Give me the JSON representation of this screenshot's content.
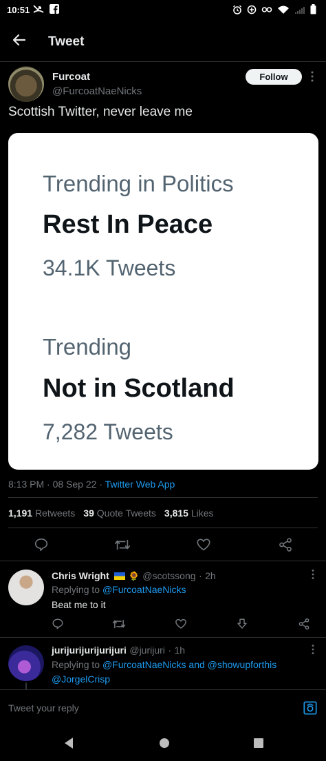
{
  "status_bar": {
    "time": "10:51"
  },
  "header": {
    "title": "Tweet"
  },
  "tweet": {
    "author_name": "Furcoat",
    "author_handle": "@FurcoatNaeNicks",
    "follow_label": "Follow",
    "text": "Scottish Twitter, never leave me",
    "image": {
      "line1": "Trending in Politics",
      "line2": "Rest In Peace",
      "line3": "34.1K Tweets",
      "line4": "Trending",
      "line5": "Not in Scotland",
      "line6": "7,282 Tweets"
    },
    "time": "8:13 PM",
    "date": "08 Sep 22",
    "source": "Twitter Web App",
    "stats": {
      "retweets_count": "1,191",
      "retweets_label": "Retweets",
      "quotes_count": "39",
      "quotes_label": "Quote Tweets",
      "likes_count": "3,815",
      "likes_label": "Likes"
    }
  },
  "replies": [
    {
      "name": "Chris Wright",
      "name_emoji": "🌻",
      "handle": "@scotssong",
      "time": "2h",
      "replying_prefix": "Replying to",
      "replying_to": "@FurcoatNaeNicks",
      "text": "Beat me to it"
    },
    {
      "name": "jurijurijurijurijuri",
      "handle": "@jurijuri",
      "time": "1h",
      "replying_prefix": "Replying to",
      "replying_to": "@FurcoatNaeNicks and @showupforthis",
      "replying_to_2": "@JorgelCrisp"
    }
  ],
  "reply_bar": {
    "placeholder": "Tweet your reply"
  },
  "colors": {
    "accent": "#1d9bf0",
    "background": "#000000",
    "muted": "#71767b"
  },
  "icons": [
    "back-arrow-icon",
    "reply-icon",
    "retweet-icon",
    "like-icon",
    "share-icon",
    "camera-icon",
    "more-icon"
  ]
}
